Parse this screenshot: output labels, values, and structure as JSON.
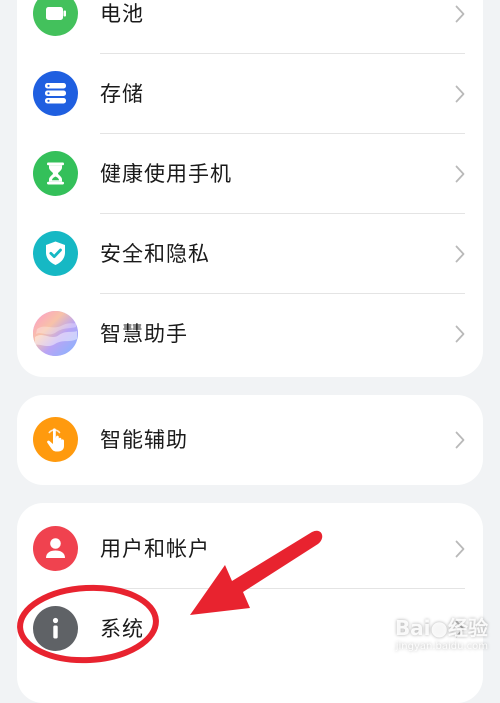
{
  "group1": {
    "items": [
      {
        "label": "电池",
        "icon": "battery-icon",
        "color": "#43c15c"
      },
      {
        "label": "存储",
        "icon": "storage-icon",
        "color": "#1f5fe0"
      },
      {
        "label": "健康使用手机",
        "icon": "hourglass-icon",
        "color": "#34c05a"
      },
      {
        "label": "安全和隐私",
        "icon": "shield-check-icon",
        "color": "#16b8c4"
      },
      {
        "label": "智慧助手",
        "icon": "assistant-orb-icon",
        "color": "#c39df0"
      }
    ]
  },
  "group2": {
    "items": [
      {
        "label": "智能辅助",
        "icon": "touch-hand-icon",
        "color": "#ff9a0e"
      }
    ]
  },
  "group3": {
    "items": [
      {
        "label": "用户和帐户",
        "icon": "user-icon",
        "color": "#f0424f"
      },
      {
        "label": "系统",
        "icon": "info-icon",
        "color": "#5f6266"
      }
    ]
  },
  "annotation": {
    "color": "#e8232f"
  },
  "watermark": {
    "brand": "Bai",
    "suffix": "经验",
    "url": "jingyan.baidu.com"
  }
}
